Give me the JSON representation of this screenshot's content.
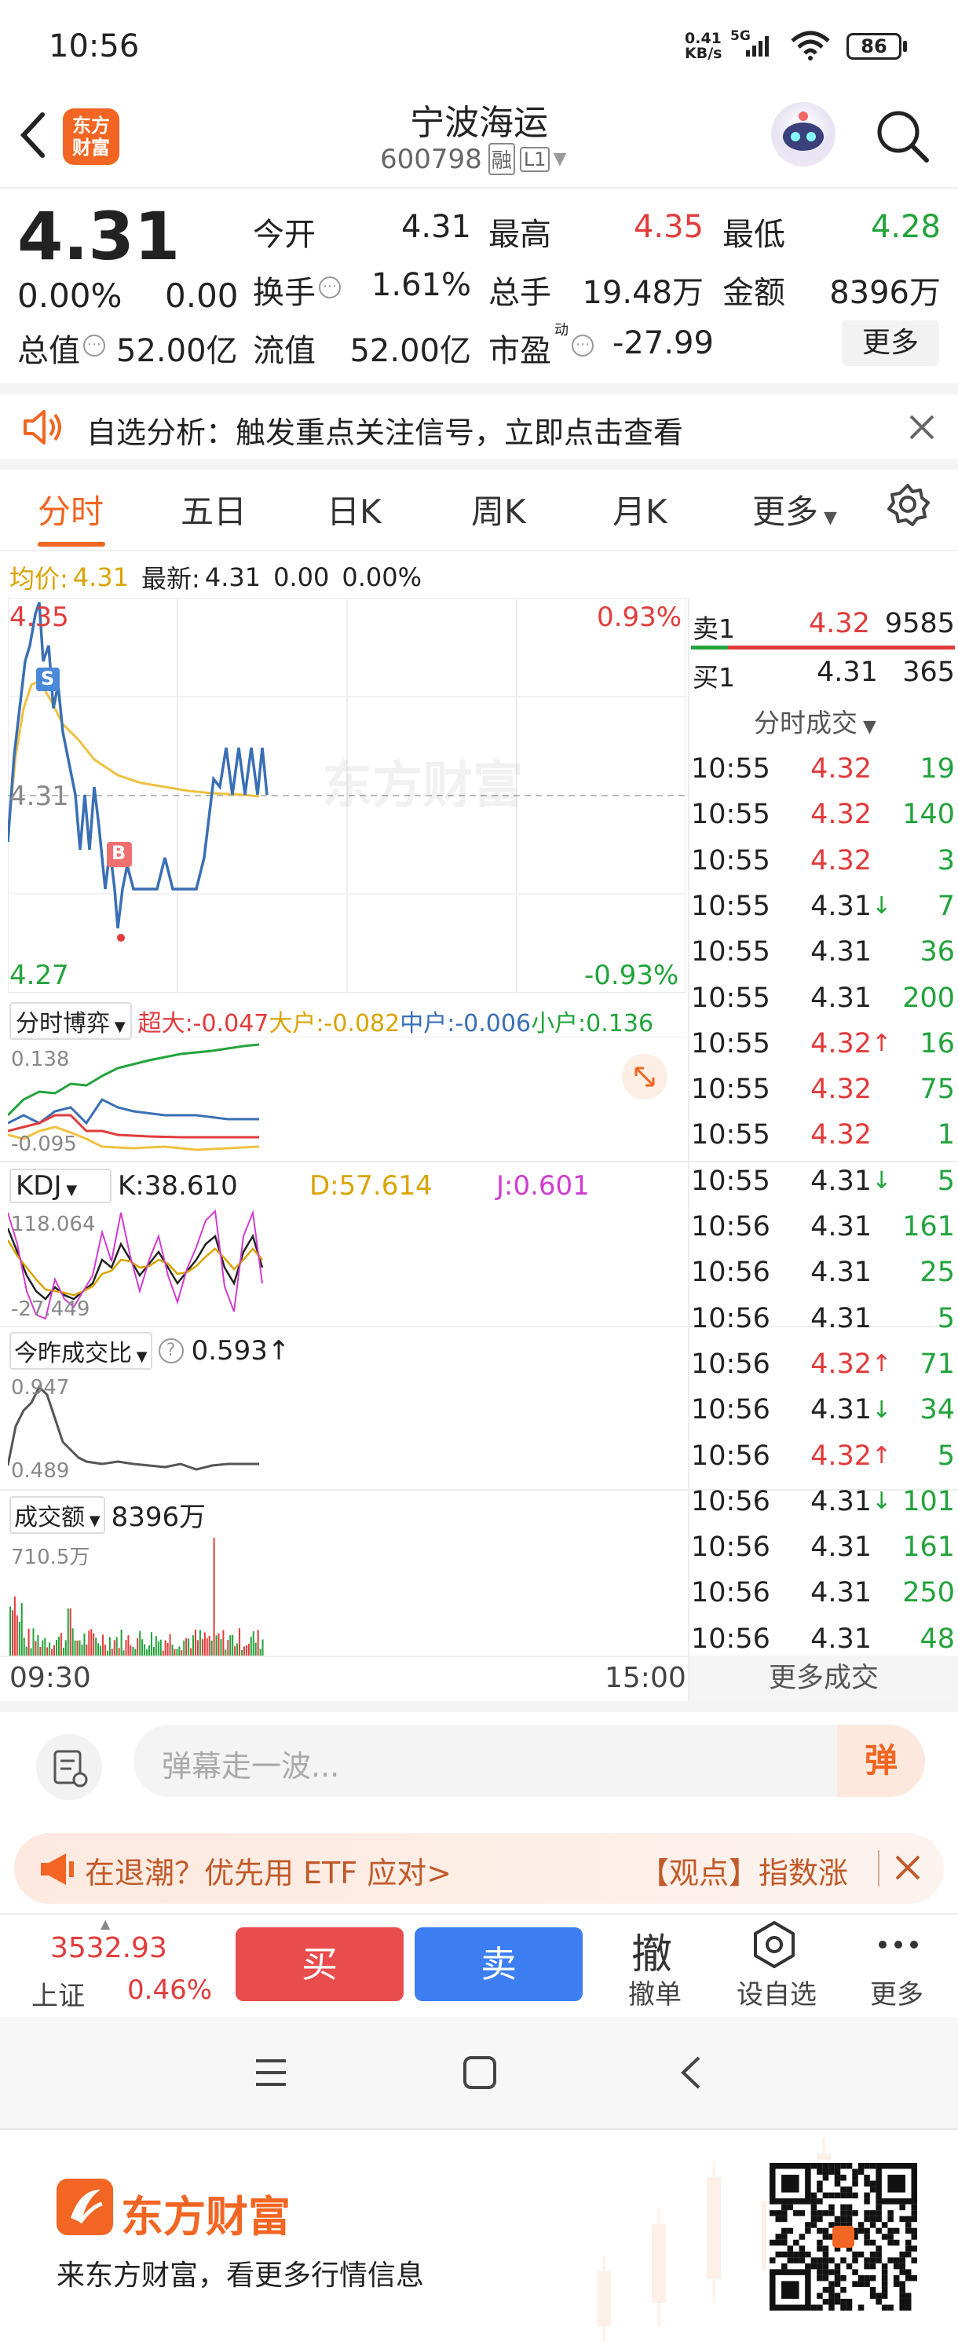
{
  "status_bar": {
    "time": "10:56",
    "net_speed_top": "0.41",
    "net_speed_bottom": "KB/s",
    "network": "5G",
    "battery": "86"
  },
  "header": {
    "stock_name": "宁波海运",
    "stock_code": "600798",
    "badge_rong": "融",
    "badge_level": "L1",
    "logo_line1": "东方",
    "logo_line2": "财富"
  },
  "quote": {
    "price": "4.31",
    "change_pct": "0.00%",
    "change": "0.00",
    "fields": [
      {
        "label": "今开",
        "value": "4.31",
        "color": "#222222"
      },
      {
        "label": "最高",
        "value": "4.35",
        "color": "#e23b3b"
      },
      {
        "label": "最低",
        "value": "4.28",
        "color": "#22a33b"
      },
      {
        "label": "换手",
        "value": "1.61%",
        "color": "#222222"
      },
      {
        "label": "总手",
        "value": "19.48万",
        "color": "#222222"
      },
      {
        "label": "金额",
        "value": "8396万",
        "color": "#222222"
      },
      {
        "label": "流值",
        "value": "52.00亿",
        "color": "#222222"
      },
      {
        "label": "市盈",
        "value": "-27.99",
        "color": "#222222"
      }
    ],
    "total_value_label": "总值",
    "total_value": "52.00亿",
    "pe_superscript": "动",
    "more_button": "更多"
  },
  "notice": {
    "text": "自选分析：触发重点关注信号，立即点击查看"
  },
  "tabs": [
    "分时",
    "五日",
    "日K",
    "周K",
    "月K",
    "更多"
  ],
  "avg_line": {
    "label_avg": "均价:",
    "avg_value": "4.31",
    "label_latest": "最新:",
    "latest": "4.31",
    "chg": "0.00",
    "pct": "0.00%"
  },
  "intraday": {
    "top_price": "4.35",
    "top_pct": "0.93%",
    "mid_price": "4.31",
    "bottom_price": "4.27",
    "bottom_pct": "-0.93%",
    "marker_s": "S",
    "marker_b": "B",
    "watermark": "东方财富",
    "time_start": "09:30",
    "time_end": "15:00"
  },
  "order_book": {
    "sell_label": "卖1",
    "sell_price": "4.32",
    "sell_vol": "9585",
    "buy_label": "买1",
    "buy_price": "4.31",
    "buy_vol": "365",
    "trades_title": "分时成交",
    "more_trades": "更多成交"
  },
  "trades": [
    {
      "t": "10:55",
      "p": "4.32",
      "a": "",
      "v": "19",
      "c": "r"
    },
    {
      "t": "10:55",
      "p": "4.32",
      "a": "",
      "v": "140",
      "c": "r"
    },
    {
      "t": "10:55",
      "p": "4.32",
      "a": "",
      "v": "3",
      "c": "r"
    },
    {
      "t": "10:55",
      "p": "4.31",
      "a": "↓",
      "v": "7",
      "c": "n"
    },
    {
      "t": "10:55",
      "p": "4.31",
      "a": "",
      "v": "36",
      "c": "n"
    },
    {
      "t": "10:55",
      "p": "4.31",
      "a": "",
      "v": "200",
      "c": "n"
    },
    {
      "t": "10:55",
      "p": "4.32",
      "a": "↑",
      "v": "16",
      "c": "r"
    },
    {
      "t": "10:55",
      "p": "4.32",
      "a": "",
      "v": "75",
      "c": "r"
    },
    {
      "t": "10:55",
      "p": "4.32",
      "a": "",
      "v": "1",
      "c": "r"
    },
    {
      "t": "10:55",
      "p": "4.31",
      "a": "↓",
      "v": "5",
      "c": "n"
    },
    {
      "t": "10:56",
      "p": "4.31",
      "a": "",
      "v": "161",
      "c": "n"
    },
    {
      "t": "10:56",
      "p": "4.31",
      "a": "",
      "v": "25",
      "c": "n"
    },
    {
      "t": "10:56",
      "p": "4.31",
      "a": "",
      "v": "5",
      "c": "n"
    },
    {
      "t": "10:56",
      "p": "4.32",
      "a": "↑",
      "v": "71",
      "c": "r"
    },
    {
      "t": "10:56",
      "p": "4.31",
      "a": "↓",
      "v": "34",
      "c": "n"
    },
    {
      "t": "10:56",
      "p": "4.32",
      "a": "↑",
      "v": "5",
      "c": "r"
    },
    {
      "t": "10:56",
      "p": "4.31",
      "a": "↓",
      "v": "101",
      "c": "n"
    },
    {
      "t": "10:56",
      "p": "4.31",
      "a": "",
      "v": "161",
      "c": "n"
    },
    {
      "t": "10:56",
      "p": "4.31",
      "a": "",
      "v": "250",
      "c": "n"
    },
    {
      "t": "10:56",
      "p": "4.31",
      "a": "",
      "v": "48",
      "c": "n"
    }
  ],
  "fund_flow": {
    "selector": "分时博弈",
    "super": "超大:-0.047",
    "large": "大户:-0.082",
    "medium": "中户:-0.006",
    "small": "小户:0.136",
    "top": "0.138",
    "bottom": "-0.095"
  },
  "kdj": {
    "selector": "KDJ",
    "k": "K:38.610",
    "d": "D:57.614",
    "j": "J:0.601",
    "top": "118.064",
    "bottom": "-27.449"
  },
  "volume_ratio": {
    "selector": "今昨成交比",
    "value": "0.593",
    "top": "0.947",
    "bottom": "0.489"
  },
  "turnover": {
    "selector": "成交额",
    "value": "8396万",
    "top": "710.5万"
  },
  "comment": {
    "placeholder": "弹幕走一波...",
    "danmu_button": "弹"
  },
  "banner": {
    "text_left": "在退潮？优先用 ETF 应对>",
    "text_right": "【观点】指数涨"
  },
  "bottom_bar": {
    "index_value": "3532.93",
    "index_name": "上证",
    "index_pct": "0.46%",
    "buy": "买",
    "sell": "卖",
    "cancel_big": "撤",
    "cancel": "撤单",
    "set_watch": "设自选",
    "more": "更多"
  },
  "footer": {
    "brand": "东方财富",
    "slogan": "来东方财富，看更多行情信息"
  },
  "colors": {
    "up": "#e23b3b",
    "down": "#22a33b",
    "accent": "#f26522",
    "buy_button": "#e94c4c",
    "sell_button": "#3d7ff2"
  }
}
